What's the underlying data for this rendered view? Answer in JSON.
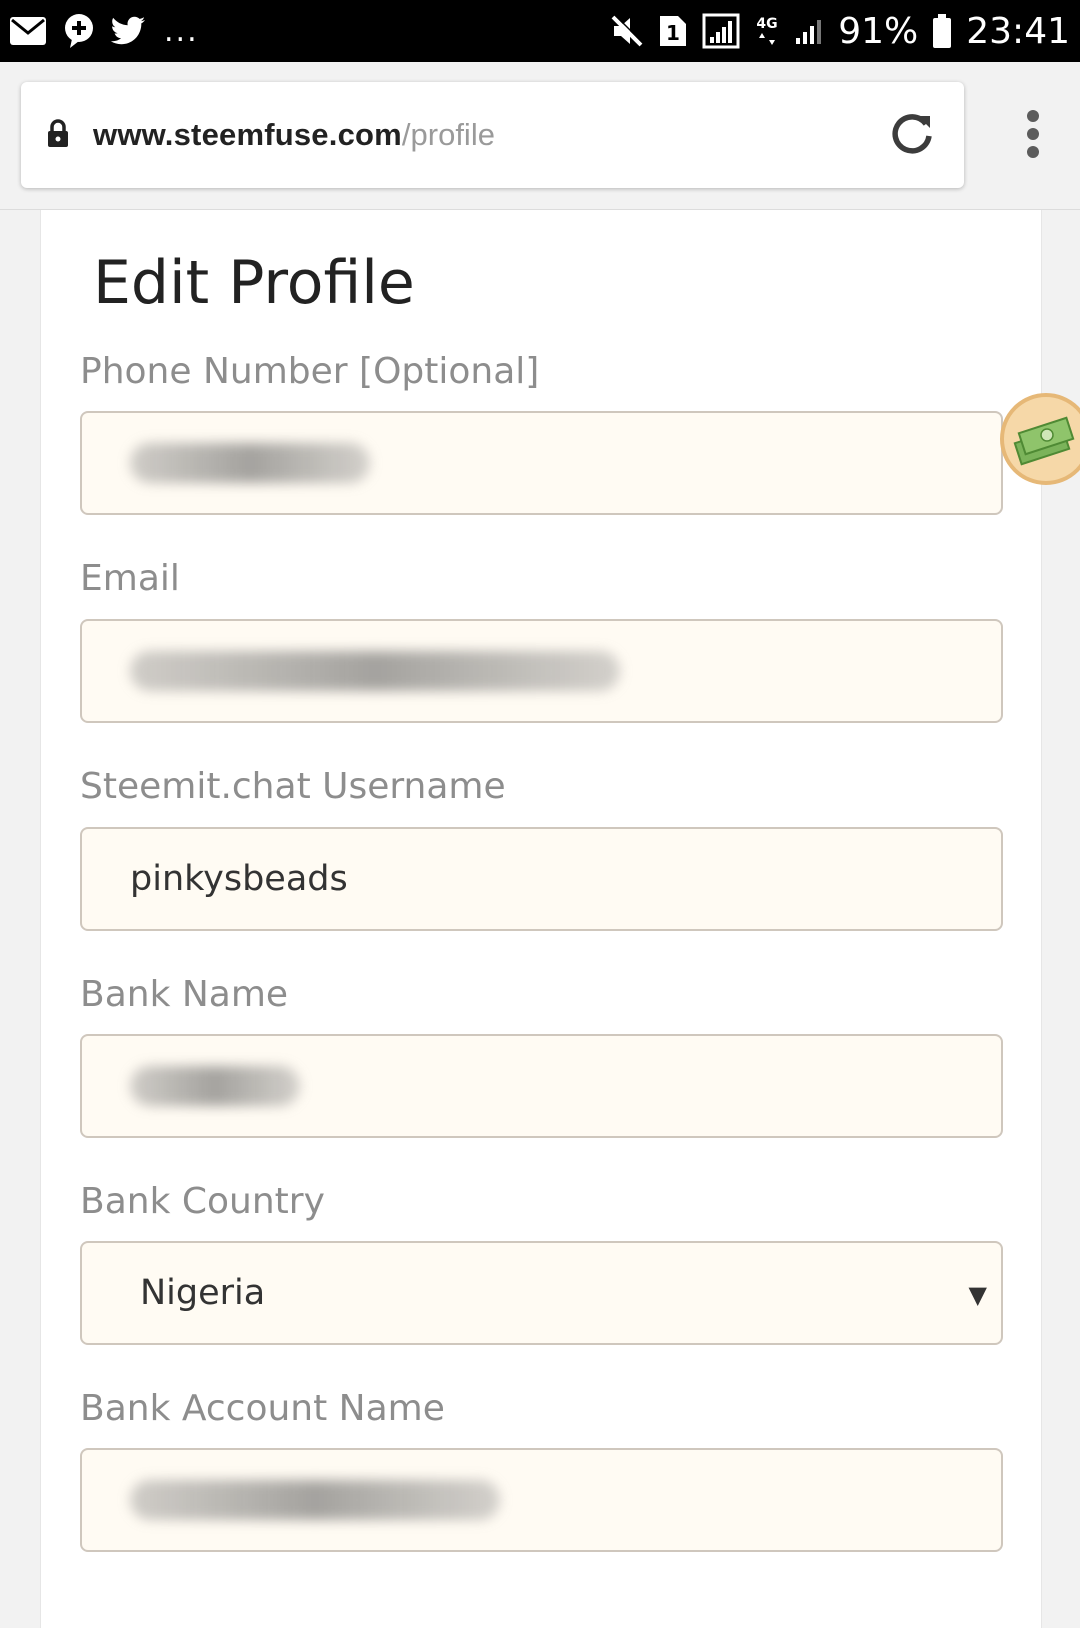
{
  "status_bar": {
    "battery": "91%",
    "time": "23:41",
    "network": "4G",
    "sim_slot": "1",
    "more_indicator": "...",
    "left_icons": [
      "mail-icon",
      "add-contact-icon",
      "twitter-icon"
    ],
    "right_icons": [
      "mute-icon",
      "sim-icon",
      "signal-icon",
      "network-icon",
      "signal-icon",
      "battery-icon"
    ]
  },
  "browser": {
    "url_host": "www.steemfuse.com",
    "url_path": "/profile",
    "icons": [
      "lock-icon",
      "reload-icon",
      "menu-icon"
    ]
  },
  "page": {
    "title": "Edit Profile",
    "fields": [
      {
        "label": "Phone Number [Optional]",
        "value": "",
        "redacted": true
      },
      {
        "label": "Email",
        "value": "",
        "redacted": true
      },
      {
        "label": "Steemit.chat Username",
        "value": "pinkysbeads",
        "redacted": false
      },
      {
        "label": "Bank Name",
        "value": "",
        "redacted": true
      },
      {
        "label": "Bank Country",
        "value": "Nigeria",
        "type": "select"
      },
      {
        "label": "Bank Account Name",
        "value": "",
        "redacted": true
      }
    ]
  },
  "colors": {
    "input_bg": "#fffbf3",
    "input_border": "#cfc7bd",
    "label": "#8d8d8d",
    "status_bar": "#000000"
  }
}
